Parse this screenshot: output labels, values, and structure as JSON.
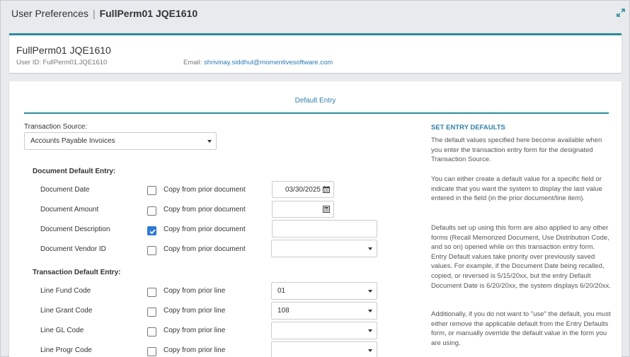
{
  "window": {
    "title": "User Preferences",
    "separator": "|",
    "user_label": "FullPerm01 JQE1610"
  },
  "user": {
    "name": "FullPerm01 JQE1610",
    "id_text": "User ID: FullPerm01.JQE1610",
    "email_label": "Email:",
    "email": "shrivinay.siddhul@momentivesoftware.com"
  },
  "form": {
    "section_title": "Default Entry",
    "transaction_source_label": "Transaction Source:",
    "transaction_source_value": "Accounts Payable Invoices",
    "document_heading": "Document Default Entry:",
    "transaction_heading": "Transaction Default Entry:",
    "rows": [
      {
        "label": "Document Date",
        "checkbox_label": "Copy from prior document",
        "checked": false,
        "value": "03/30/2025",
        "kind": "date"
      },
      {
        "label": "Document Amount",
        "checkbox_label": "Copy from prior document",
        "checked": false,
        "value": "",
        "kind": "amount"
      },
      {
        "label": "Document Description",
        "checkbox_label": "Copy from prior document",
        "checked": true,
        "value": "",
        "kind": "text"
      },
      {
        "label": "Document Vendor ID",
        "checkbox_label": "Copy from prior document",
        "checked": false,
        "value": "",
        "kind": "select"
      },
      {
        "label": "Line Fund Code",
        "checkbox_label": "Copy from prior line",
        "checked": false,
        "value": "01",
        "kind": "select"
      },
      {
        "label": "Line Grant Code",
        "checkbox_label": "Copy from prior line",
        "checked": false,
        "value": "108",
        "kind": "select"
      },
      {
        "label": "Line GL Code",
        "checkbox_label": "Copy from prior line",
        "checked": false,
        "value": "",
        "kind": "select"
      },
      {
        "label": "Line Progr Code",
        "checkbox_label": "Copy from prior line",
        "checked": false,
        "value": "",
        "kind": "select"
      }
    ]
  },
  "help": {
    "title": "SET ENTRY DEFAULTS",
    "paragraphs": [
      "The default values specified here become available when you enter the transaction entry form for the designated Transaction Source.",
      "You can either create a default value for a specific field or indicate that you want the system to display the last value entered in the field (in the prior document/line item).",
      "Defaults set up using this form are also applied to any other forms (Recall Memorized Document, Use Distribution Code, and so on) opened while on this transaction entry form. Entry Default values take priority over previously saved values. For example, if the Document Date being recalled, copied, or reversed is 5/15/20xx, but the entry Default Document Date is 6/20/20xx, the system displays 6/20/20xx.",
      "Additionally, if you do not want to \"use\" the default, you must either remove the applicable default from the Entry Defaults form, or manually override the default value in the form you are using."
    ]
  },
  "colors": {
    "accent": "#2e8b9b",
    "link": "#2d7bb4",
    "heading_blue": "#2e7fa7",
    "checkbox_checked": "#2d7bd4"
  },
  "icons": {
    "expand": "expand-icon",
    "calendar": "calendar-icon",
    "calculator": "calculator-icon",
    "dropdown": "chevron-down-icon",
    "check": "checkmark-icon"
  }
}
